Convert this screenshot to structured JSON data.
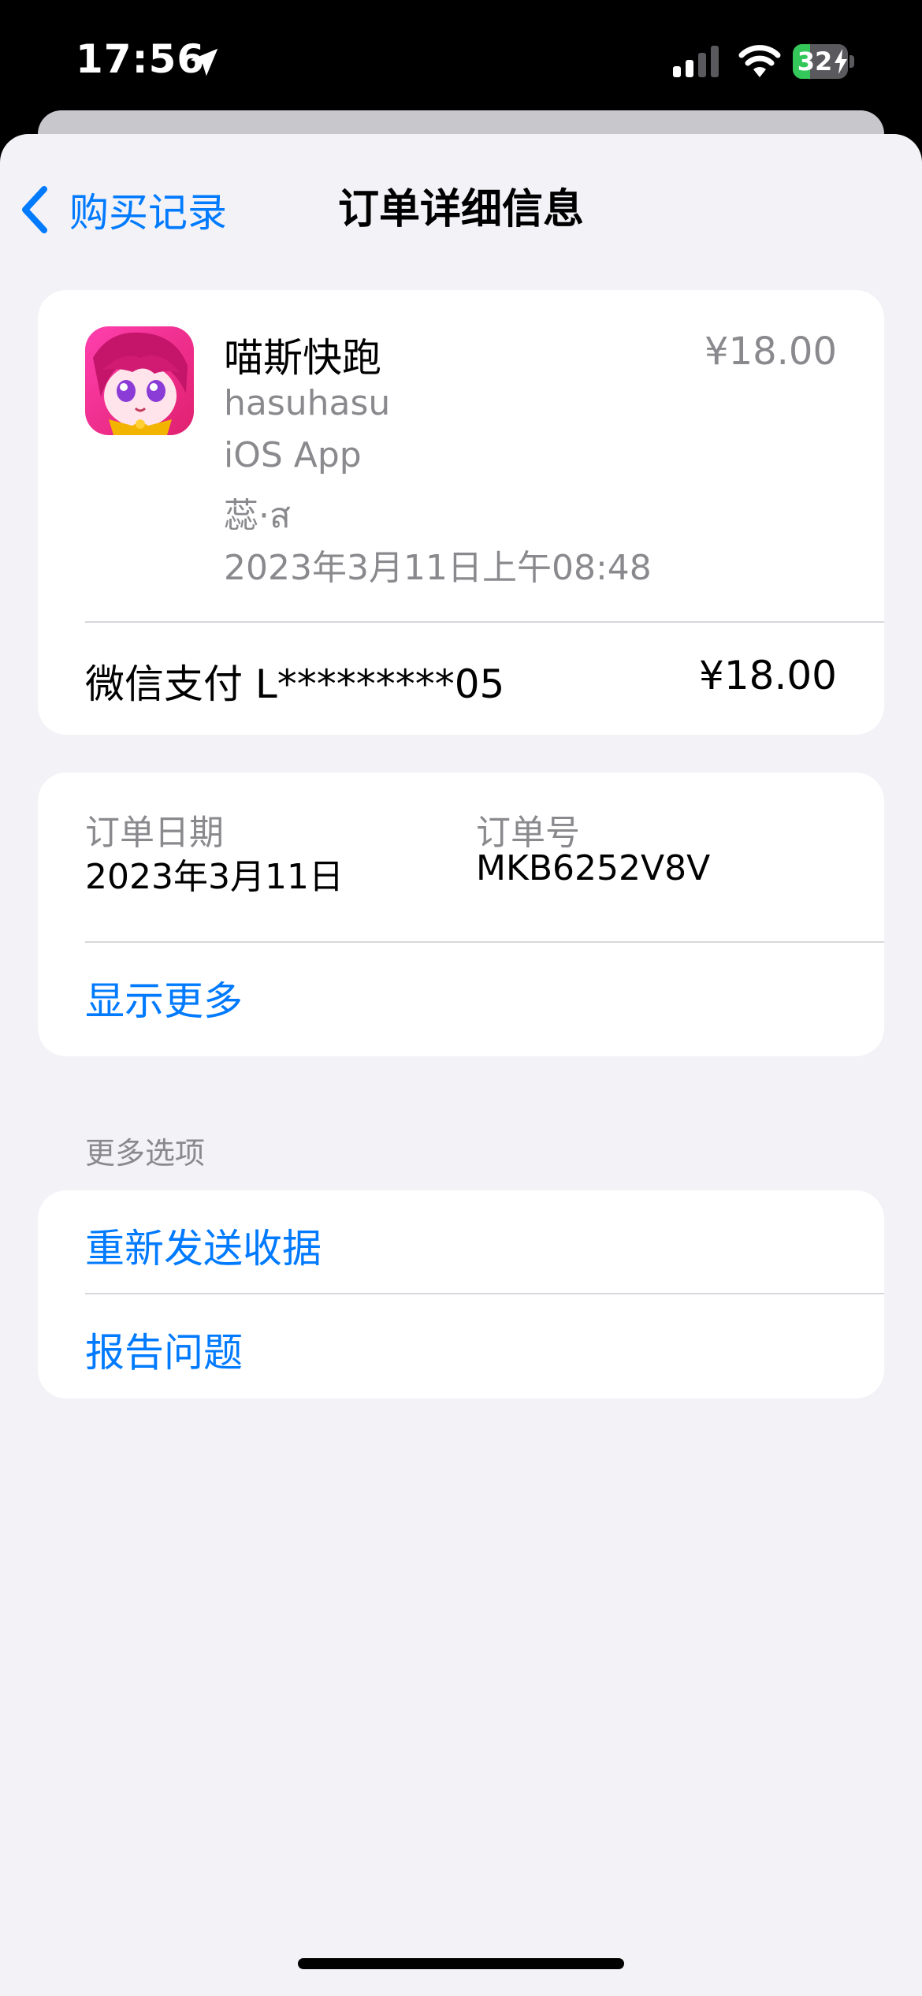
{
  "status_bar": {
    "time": "17:56",
    "battery_level": "32",
    "battery_fraction": 0.32
  },
  "nav": {
    "back_label": "购买记录",
    "title": "订单详细信息"
  },
  "purchase": {
    "app_name": "喵斯快跑",
    "developer": "hasuhasu",
    "platform": "iOS App",
    "device": "蕊·ส",
    "datetime": "2023年3月11日上午08:48",
    "price": "¥18.00"
  },
  "payment": {
    "method": "微信支付 L*********05",
    "amount": "¥18.00"
  },
  "order": {
    "date_label": "订单日期",
    "date_value": "2023年3月11日",
    "number_label": "订单号",
    "number_value": "MKB6252V8V",
    "show_more": "显示更多"
  },
  "more_options": {
    "header": "更多选项",
    "resend_receipt": "重新发送收据",
    "report_problem": "报告问题"
  },
  "colors": {
    "accent": "#007aff",
    "background": "#f2f2f7",
    "battery_green": "#34c759"
  },
  "icons": [
    "location-arrow-icon",
    "cellular-signal-icon",
    "wifi-icon",
    "battery-icon",
    "charging-bolt-icon",
    "chevron-left-icon",
    "app-icon"
  ]
}
